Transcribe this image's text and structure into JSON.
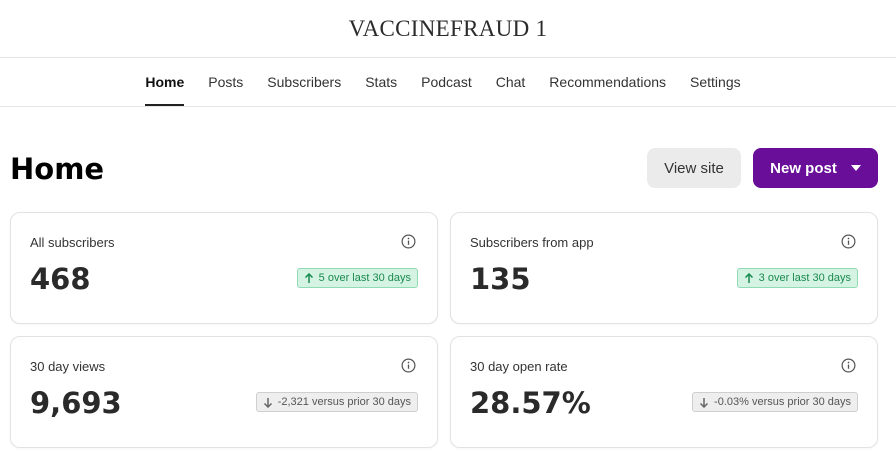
{
  "publication": {
    "title": "VACCINEFRAUD 1"
  },
  "nav": {
    "tabs": [
      "Home",
      "Posts",
      "Subscribers",
      "Stats",
      "Podcast",
      "Chat",
      "Recommendations",
      "Settings"
    ],
    "active": "Home"
  },
  "page": {
    "title": "Home",
    "view_site_label": "View site",
    "new_post_label": "New post"
  },
  "cards": [
    {
      "label": "All subscribers",
      "value": "468",
      "trend": "up",
      "delta": "5 over last 30 days"
    },
    {
      "label": "Subscribers from app",
      "value": "135",
      "trend": "up",
      "delta": "3 over last 30 days"
    },
    {
      "label": "30 day views",
      "value": "9,693",
      "trend": "down",
      "delta": "-2,321 versus prior 30 days"
    },
    {
      "label": "30 day open rate",
      "value": "28.57%",
      "trend": "down",
      "delta": "-0.03% versus prior 30 days"
    }
  ],
  "colors": {
    "accent": "#680e99",
    "up_bg": "#d4f3e3",
    "up_text": "#1a8a4e",
    "down_bg": "#eeeeee"
  }
}
